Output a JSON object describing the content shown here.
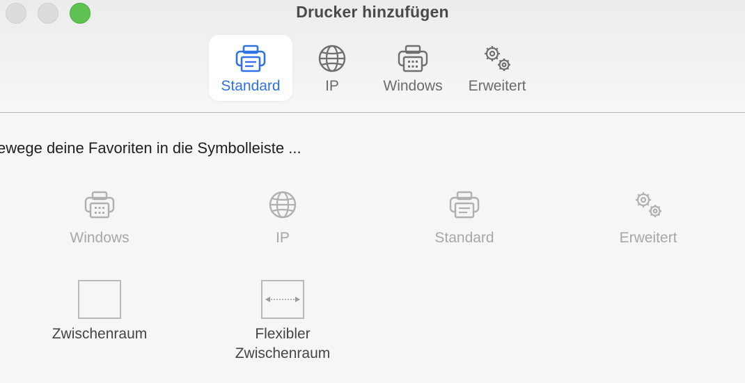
{
  "window": {
    "title": "Drucker hinzufügen",
    "accent_color": "#2f72e4"
  },
  "toolbar": {
    "items": [
      {
        "label": "Standard",
        "icon": "printer-icon",
        "selected": true
      },
      {
        "label": "IP",
        "icon": "globe-icon",
        "selected": false
      },
      {
        "label": "Windows",
        "icon": "windows-printer-icon",
        "selected": false
      },
      {
        "label": "Erweitert",
        "icon": "gears-icon",
        "selected": false
      }
    ]
  },
  "customize": {
    "instruction": "ewege deine Favoriten in die Symbolleiste ...",
    "palette": [
      {
        "label": "Windows",
        "icon": "windows-printer-icon"
      },
      {
        "label": "IP",
        "icon": "globe-icon"
      },
      {
        "label": "Standard",
        "icon": "printer-icon"
      },
      {
        "label": "Erweitert",
        "icon": "gears-icon"
      }
    ],
    "spaces": [
      {
        "label": "Zwischenraum"
      },
      {
        "label_line1": "Flexibler",
        "label_line2": "Zwischenraum"
      }
    ]
  }
}
